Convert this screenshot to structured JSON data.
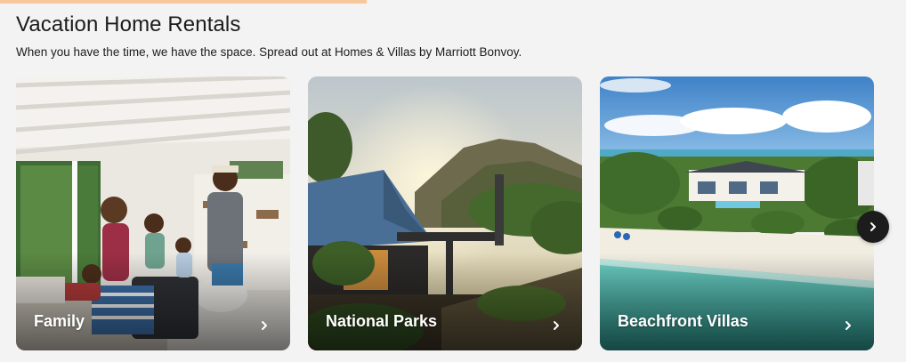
{
  "section": {
    "title": "Vacation Home Rentals",
    "subtitle": "When you have the time, we have the space. Spread out at Homes & Villas by Marriott Bonvoy."
  },
  "cards": [
    {
      "label": "Family",
      "icon": "chevron-right-icon"
    },
    {
      "label": "National Parks",
      "icon": "chevron-right-icon"
    },
    {
      "label": "Beachfront Villas",
      "icon": "chevron-right-icon"
    }
  ],
  "carousel": {
    "next_icon": "chevron-right-icon"
  },
  "colors": {
    "background": "#f3f3f3",
    "accent": "#f6c89a",
    "text": "#1c1c1c",
    "next_button": "#1c1c1c"
  }
}
